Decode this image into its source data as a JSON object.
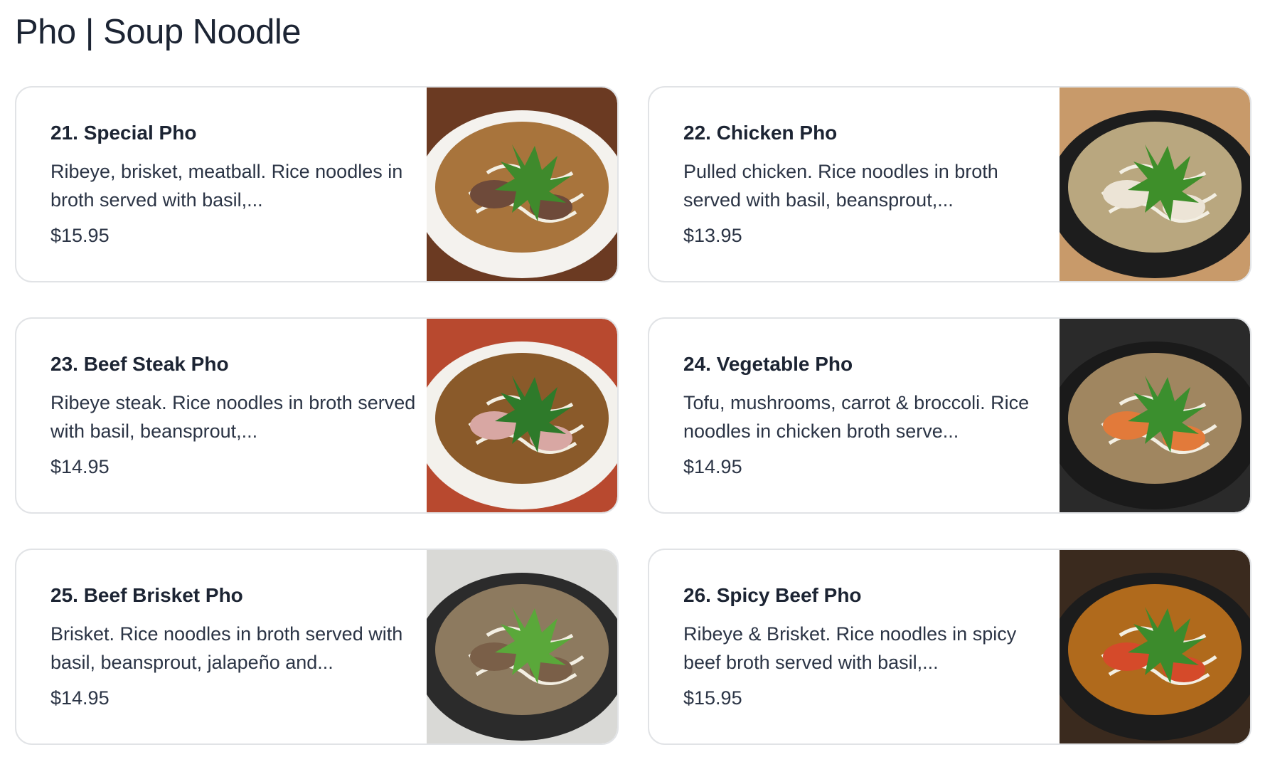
{
  "section": {
    "title": "Pho | Soup Noodle"
  },
  "items": [
    {
      "name": "21. Special Pho",
      "description": "Ribeye, brisket, meatball. Rice noodles in broth served with basil,...",
      "price": "$15.95",
      "image_icon": "special-pho-photo",
      "colors": {
        "bg": "#6b3a22",
        "bowl": "#f4f2ee",
        "broth": "#a8743c",
        "accent": "#3f8a2c",
        "meat": "#6e4a3a"
      }
    },
    {
      "name": "22. Chicken Pho",
      "description": "Pulled chicken. Rice noodles in broth served with basil, beansprout,...",
      "price": "$13.95",
      "image_icon": "chicken-pho-photo",
      "colors": {
        "bg": "#c89a6a",
        "bowl": "#1d1d1d",
        "broth": "#b9a77f",
        "accent": "#3e8f2a",
        "meat": "#ece4d6"
      }
    },
    {
      "name": "23. Beef Steak Pho",
      "description": "Ribeye steak. Rice noodles in broth served with basil, beansprout,...",
      "price": "$14.95",
      "image_icon": "beef-steak-pho-photo",
      "colors": {
        "bg": "#b8492f",
        "bowl": "#f3f1ec",
        "broth": "#8a5a2a",
        "accent": "#2e7a2a",
        "meat": "#d8a7a3"
      }
    },
    {
      "name": "24. Vegetable Pho",
      "description": "Tofu, mushrooms, carrot & broccoli. Rice noodles in chicken broth serve...",
      "price": "$14.95",
      "image_icon": "vegetable-pho-photo",
      "colors": {
        "bg": "#2a2a2a",
        "bowl": "#1a1a1a",
        "broth": "#a08660",
        "accent": "#3b8f2e",
        "meat": "#e27a3a"
      }
    },
    {
      "name": "25. Beef Brisket Pho",
      "description": "Brisket. Rice noodles in broth served with basil, beansprout, jalapeño and...",
      "price": "$14.95",
      "image_icon": "beef-brisket-pho-photo",
      "colors": {
        "bg": "#d9d9d6",
        "bowl": "#2b2b2b",
        "broth": "#8d7a5f",
        "accent": "#5aa83a",
        "meat": "#7a5f48"
      }
    },
    {
      "name": "26. Spicy Beef Pho",
      "description": "Ribeye & Brisket. Rice noodles in spicy beef broth served with basil,...",
      "price": "$15.95",
      "image_icon": "spicy-beef-pho-photo",
      "colors": {
        "bg": "#3a2a1e",
        "bowl": "#1c1c1c",
        "broth": "#b06a1c",
        "accent": "#3c8b2c",
        "meat": "#d54a2a"
      }
    }
  ]
}
